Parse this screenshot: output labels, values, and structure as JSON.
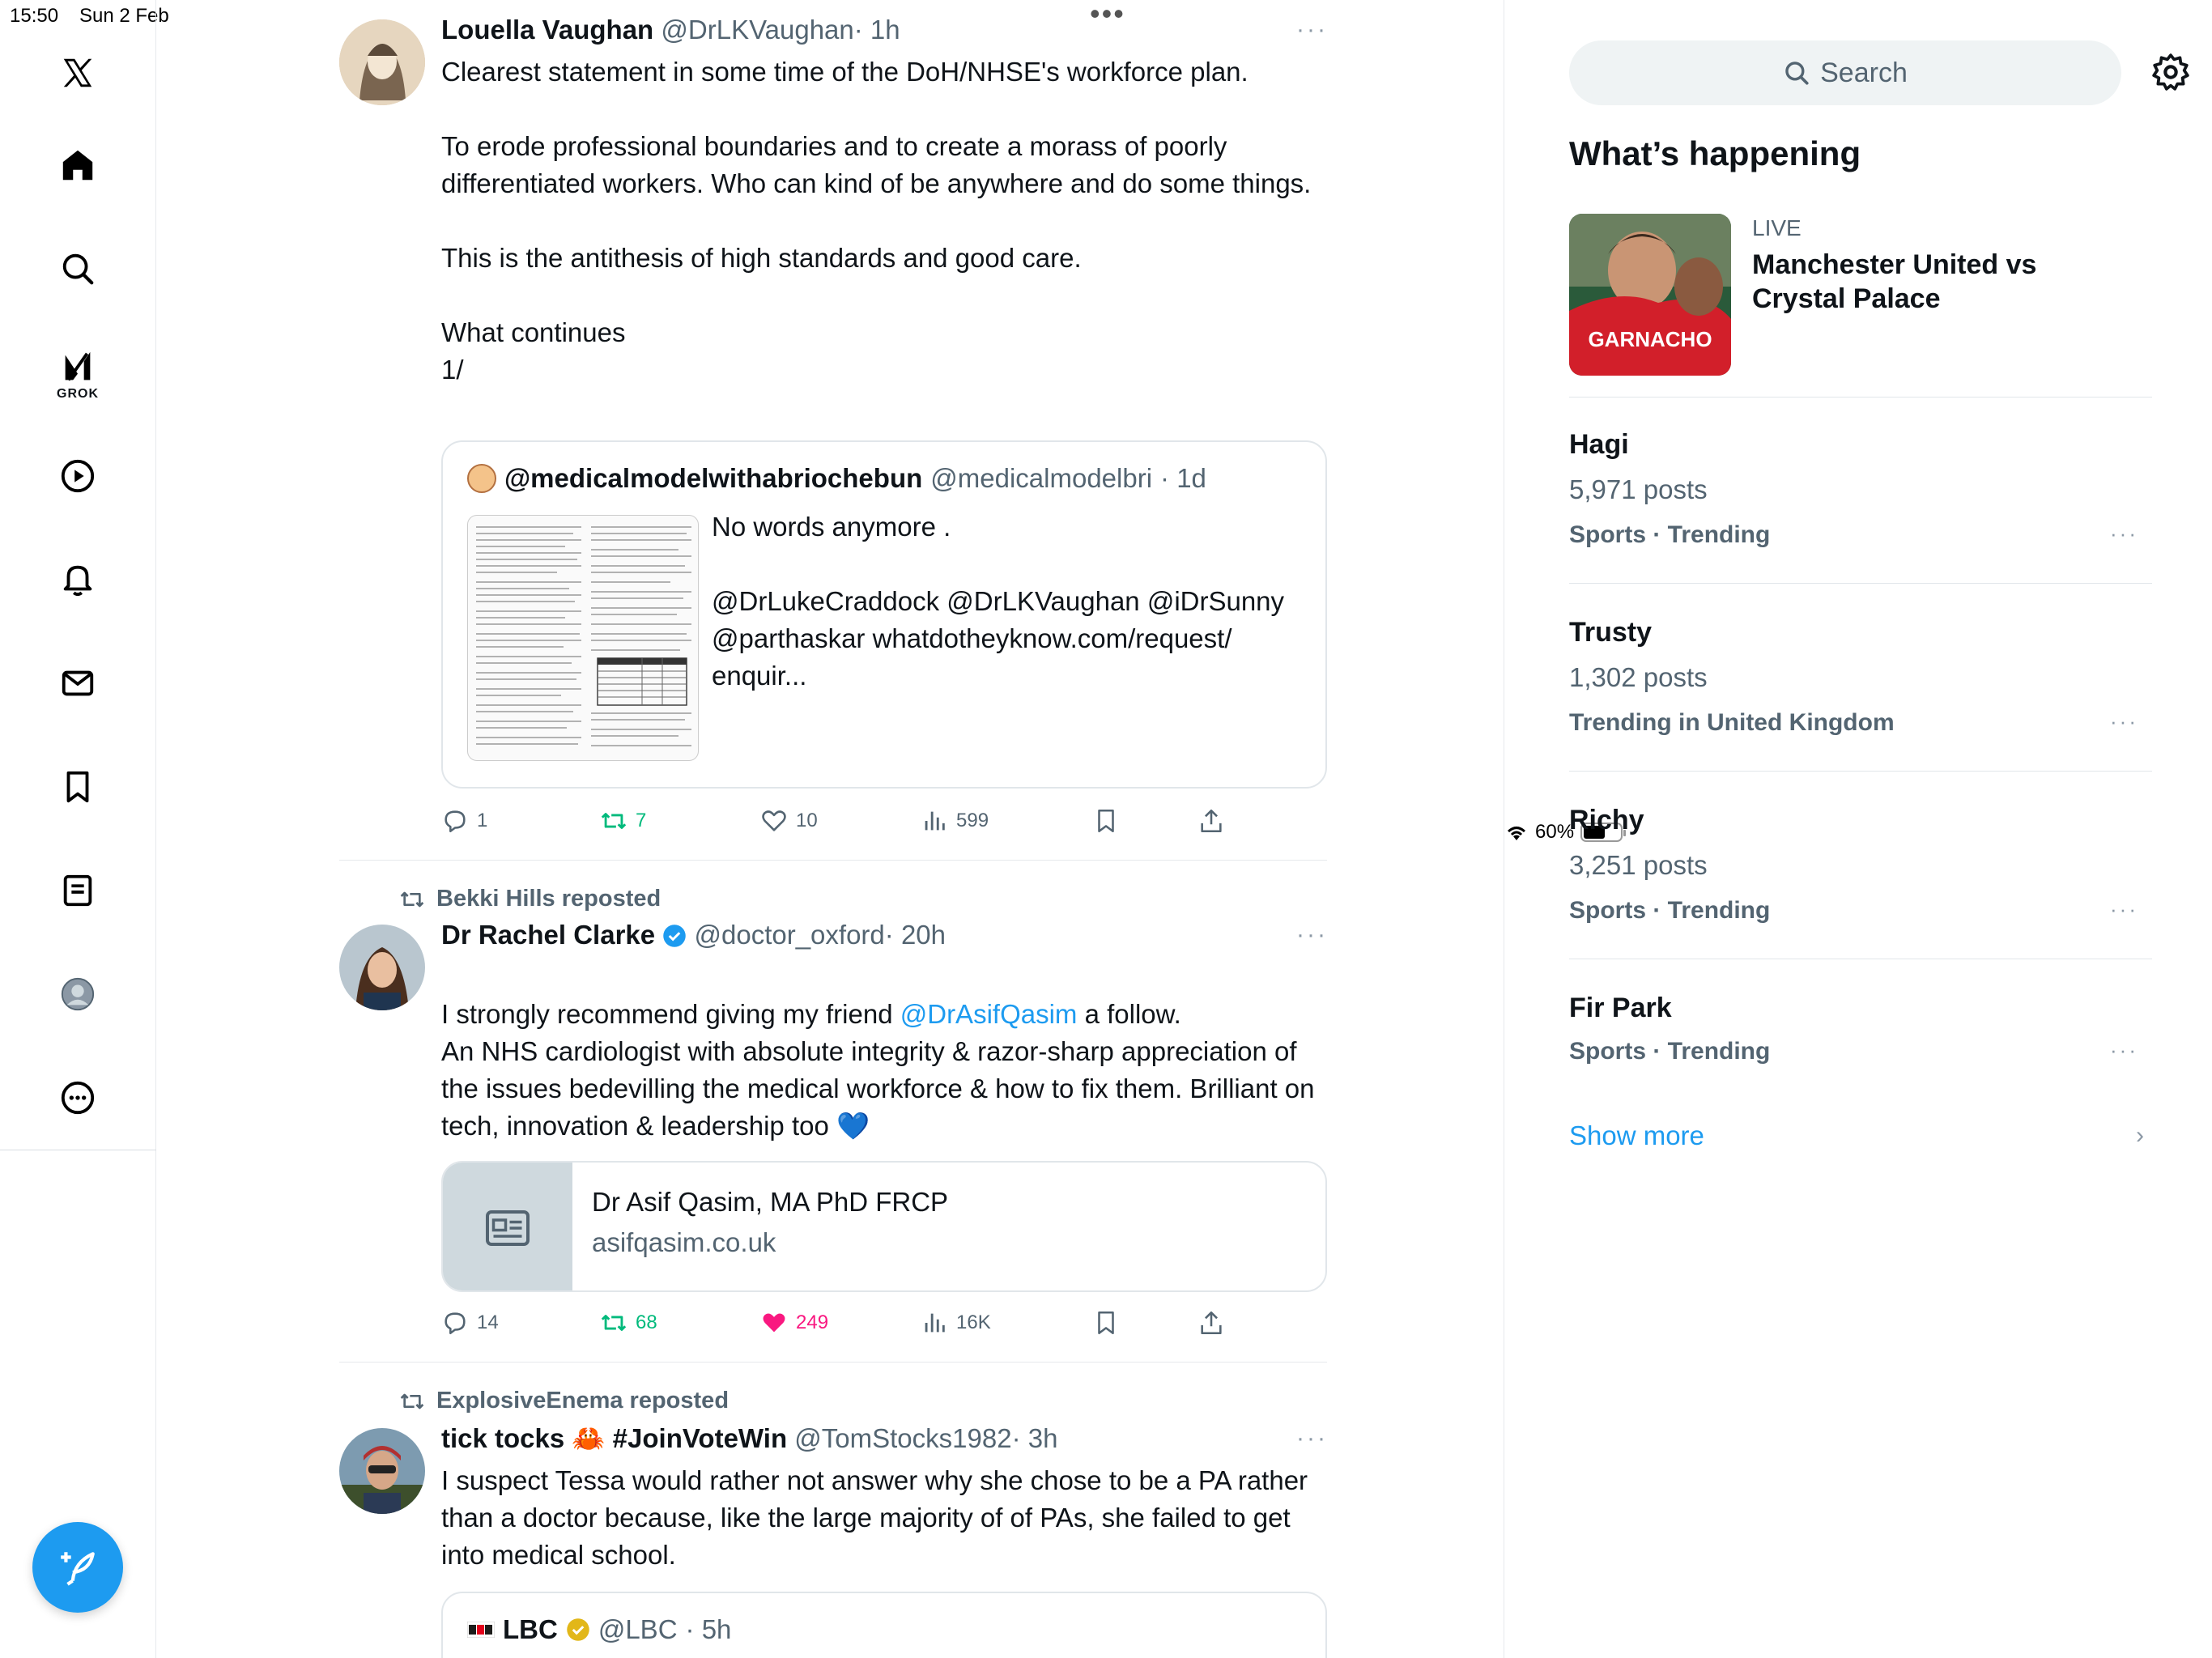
{
  "status": {
    "time": "15:50",
    "date": "Sun 2 Feb",
    "battery": "60%",
    "battery_level": 0.6
  },
  "nav": {
    "items": [
      "x-logo",
      "home",
      "explore",
      "grok",
      "video",
      "notifications",
      "messages",
      "bookmarks",
      "lists",
      "profile",
      "more"
    ],
    "grok_label": "GROK"
  },
  "feed": {
    "tweets": [
      {
        "name": "Louella Vaughan",
        "handle": "@DrLKVaughan",
        "time": "· 1h",
        "text": "Clearest statement in some time of the DoH/NHSE's workforce plan.\n\nTo erode professional boundaries and to create a morass of poorly differentiated workers. Who can kind of be anywhere and do some things.\n\nThis is the antithesis of high standards and good care.\n\nWhat continues\n1/",
        "quote": {
          "name": "@medicalmodelwithabriochebun",
          "handle": "@medicalmodelbri",
          "time": "· 1d",
          "text": "No words anymore .\n\n@DrLukeCraddock @DrLKVaughan @iDrSunny @parthaskar whatdotheyknow.com/request/\nenquir..."
        },
        "actions": {
          "replies": "1",
          "reposts": "7",
          "likes": "10",
          "views": "599"
        }
      },
      {
        "reposted_by": "Bekki Hills reposted",
        "name": "Dr Rachel Clarke",
        "handle": "@doctor_oxford",
        "time": "· 20h",
        "text_pre": "I strongly recommend giving my friend ",
        "mention": "@DrAsifQasim",
        "text_post": " a follow.",
        "text2": "An NHS cardiologist with absolute integrity & razor-sharp appreciation of the issues bedevilling the medical workforce & how to fix them. Brilliant on tech, innovation & leadership too 💙",
        "card": {
          "title": "Dr Asif Qasim, MA PhD FRCP",
          "domain": "asifqasim.co.uk"
        },
        "actions": {
          "replies": "14",
          "reposts": "68",
          "likes": "249",
          "views": "16K"
        }
      },
      {
        "reposted_by": "ExplosiveEnema reposted",
        "name": "tick tocks 🦀 #JoinVoteWin",
        "handle": "@TomStocks1982",
        "time": "· 3h",
        "text": "I suspect Tessa would rather not answer why she chose to be a PA rather than a doctor because, like the large majority of of PAs, she failed to get into medical school.",
        "quote": {
          "name": "LBC",
          "handle": "@LBC",
          "time": "· 5h"
        }
      }
    ]
  },
  "sidebar": {
    "search_placeholder": "Search",
    "section_title": "What’s happening",
    "live": {
      "label": "LIVE",
      "title": "Manchester United vs Crystal Palace",
      "thumb_text": "GARNACHO"
    },
    "trends": [
      {
        "name": "Hagi",
        "count": "5,971 posts",
        "category": "Sports · Trending"
      },
      {
        "name": "Trusty",
        "count": "1,302 posts",
        "category": "Trending in United Kingdom"
      },
      {
        "name": "Richy",
        "count": "3,251 posts",
        "category": "Sports · Trending"
      },
      {
        "name": "Fir Park",
        "count": "",
        "category": "Sports · Trending"
      }
    ],
    "show_more": "Show more"
  },
  "colors": {
    "accent": "#1d9bf0",
    "repost_green": "#00ba7c",
    "like_pink": "#f91880",
    "muted": "#536471"
  }
}
